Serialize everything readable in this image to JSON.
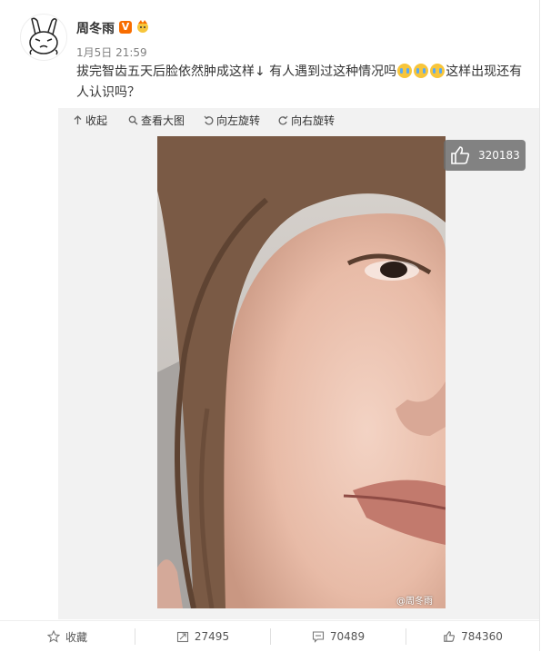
{
  "post": {
    "author": "周冬雨",
    "verified_badge": "V",
    "time": "1月5日 21:59",
    "text_a": "拔完智齿五天后脸依然肿成这样↓ 有人遇到过这种情况吗",
    "text_b": "这样出现还有人认识吗？"
  },
  "media_toolbar": {
    "collapse": "收起",
    "view_large": "查看大图",
    "rotate_left": "向左旋转",
    "rotate_right": "向右旋转"
  },
  "photo": {
    "watermark": "@周冬雨",
    "like_count": "320183"
  },
  "footer": {
    "favorite": "收藏",
    "repost_count": "27495",
    "comment_count": "70489",
    "like_count": "784360"
  },
  "colors": {
    "accent": "#f86d00",
    "emoji_face": "#f7c53b",
    "emoji_tear": "#5aa9f2"
  },
  "icons": [
    "bunny-avatar",
    "verified-icon",
    "fan-badge-icon",
    "crying-emoji-icon",
    "collapse-icon",
    "search-icon",
    "rotate-left-icon",
    "rotate-right-icon",
    "thumbs-up-icon",
    "star-icon",
    "repost-icon",
    "comment-icon"
  ]
}
